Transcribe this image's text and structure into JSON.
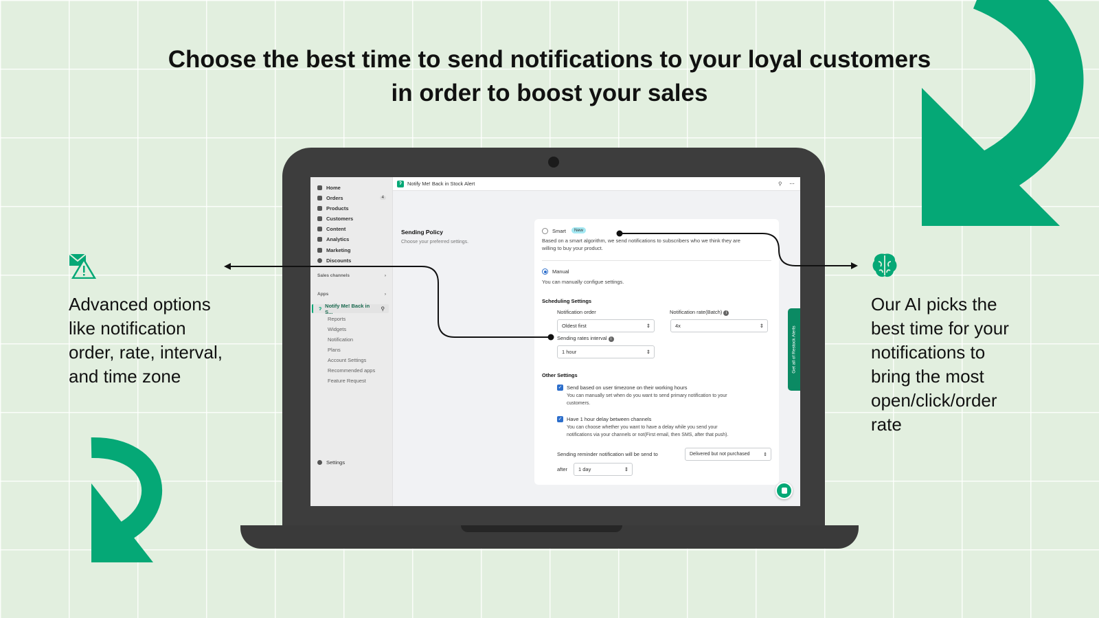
{
  "headline": {
    "line1": "Choose the best time to send notifications to your loyal customers",
    "line2": "in order to boost your sales"
  },
  "left_annotation": {
    "icon": "mail-warning-icon",
    "lines": [
      "Advanced options",
      "like notification",
      "order, rate, interval,",
      "and time zone"
    ]
  },
  "right_annotation": {
    "icon": "brain-icon",
    "lines": [
      "Our AI picks the",
      "best time for your",
      "notifications to",
      "bring the most",
      "open/click/order",
      "rate"
    ]
  },
  "colors": {
    "accent": "#05a876",
    "background": "#e2efdf",
    "laptop": "#3d3d3d",
    "primary_blue": "#2c6ecb"
  },
  "sidebar": {
    "items": [
      {
        "label": "Home",
        "icon": "home-icon"
      },
      {
        "label": "Orders",
        "icon": "orders-icon",
        "badge": "4"
      },
      {
        "label": "Products",
        "icon": "tag-icon"
      },
      {
        "label": "Customers",
        "icon": "person-icon"
      },
      {
        "label": "Content",
        "icon": "content-icon"
      },
      {
        "label": "Analytics",
        "icon": "bar-chart-icon"
      },
      {
        "label": "Marketing",
        "icon": "marketing-icon"
      },
      {
        "label": "Discounts",
        "icon": "discount-icon"
      }
    ],
    "sales_channels": "Sales channels",
    "apps": "Apps",
    "app_name": "Notify Me! Back in S...",
    "app_subitems": [
      "Reports",
      "Widgets",
      "Notification",
      "Plans",
      "Account Settings",
      "Recommended apps",
      "Feature Request"
    ],
    "settings": "Settings"
  },
  "topbar": {
    "title": "Notify Me! Back in Stock Alert"
  },
  "section": {
    "title": "Sending Policy",
    "subtitle": "Choose your preferred settings."
  },
  "policy": {
    "smart_label": "Smart",
    "smart_badge": "New",
    "smart_selected": false,
    "smart_desc_1": "Based on a smart algorithm, we send notifications to subscribers who we think they are",
    "smart_desc_2": "willing to buy your product.",
    "manual_label": "Manual",
    "manual_selected": true,
    "manual_desc": "You can manually configue settings."
  },
  "scheduling": {
    "title": "Scheduling Settings",
    "order_label": "Notification order",
    "order_value": "Oldest first",
    "rate_label": "Notification rate(Batch)",
    "rate_value": "4x",
    "interval_label": "Sending rates interval",
    "interval_value": "1 hour"
  },
  "other": {
    "title": "Other Settings",
    "opt1_label": "Send based on user timezone on their working hours",
    "opt1_checked": true,
    "opt1_desc_1": "You can manually set when do you want to send primary notification to your",
    "opt1_desc_2": "customers.",
    "opt2_label": "Have 1 hour delay between channels",
    "opt2_checked": true,
    "opt2_desc_1": "You can choose whether you want to have a delay while you send your",
    "opt2_desc_2": "notifications via your channels or not(First email, then SMS, after that push).",
    "reminder_label": "Sending reminder notification will be send to",
    "reminder_value": "Delivered but not purchased",
    "after_label": "after",
    "after_value": "1 day"
  },
  "side_tab": "Get all of Restock Alerts"
}
